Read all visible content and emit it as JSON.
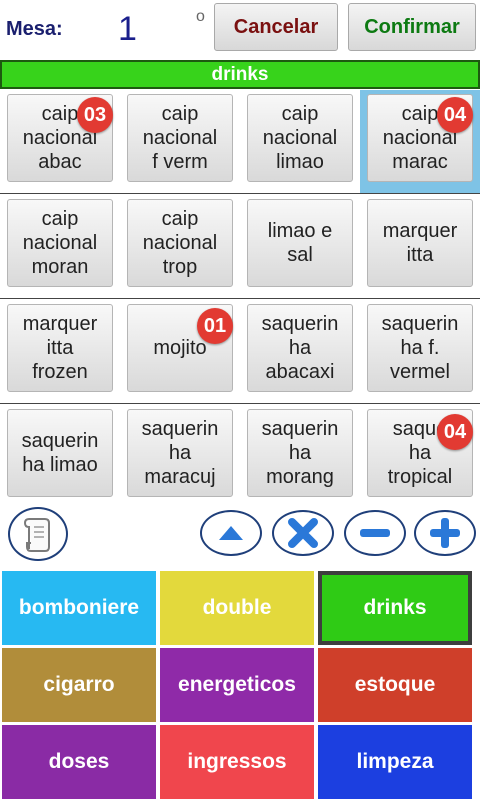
{
  "header": {
    "mesa_label": "Mesa:",
    "mesa_value": "1",
    "mesa_suffix": "o",
    "cancel_label": "Cancelar",
    "confirm_label": "Confirmar"
  },
  "current_category": "drinks",
  "products": [
    {
      "label": "caip\nnacional\nabac",
      "badge": "03"
    },
    {
      "label": "caip\nnacional\nf verm",
      "badge": ""
    },
    {
      "label": "caip\nnacional\nlimao",
      "badge": ""
    },
    {
      "label": "caip\nnacional\nmarac",
      "badge": "04"
    },
    {
      "label": "caip\nnacional\nmoran",
      "badge": ""
    },
    {
      "label": "caip\nnacional\ntrop",
      "badge": ""
    },
    {
      "label": "limao e\nsal",
      "badge": ""
    },
    {
      "label": "marquer\nitta",
      "badge": ""
    },
    {
      "label": "marquer\nitta\nfrozen",
      "badge": ""
    },
    {
      "label": "mojito",
      "badge": "01"
    },
    {
      "label": "saquerin\nha\nabacaxi",
      "badge": ""
    },
    {
      "label": "saquerin\nha f.\nvermel",
      "badge": ""
    },
    {
      "label": "saquerin\nha limao",
      "badge": ""
    },
    {
      "label": "saquerin\nha\nmaracuj",
      "badge": ""
    },
    {
      "label": "saquerin\nha\nmorang",
      "badge": ""
    },
    {
      "label": "saque\nha\ntropical",
      "badge": "04"
    }
  ],
  "categories": [
    {
      "label": "bomboniere",
      "color": "#27b9f2"
    },
    {
      "label": "double",
      "color": "#e3d93c"
    },
    {
      "label": "drinks",
      "color": "#2fcb15"
    },
    {
      "label": "cigarro",
      "color": "#b18d3a"
    },
    {
      "label": "energeticos",
      "color": "#8f2aa8"
    },
    {
      "label": "estoque",
      "color": "#cf3f2a"
    },
    {
      "label": "doses",
      "color": "#8a2ba5"
    },
    {
      "label": "ingressos",
      "color": "#f0464d"
    },
    {
      "label": "limpeza",
      "color": "#1c3fe0"
    }
  ],
  "icons": [
    "scroll-icon",
    "arrow-up-icon",
    "remove-x-icon",
    "minus-icon",
    "plus-icon"
  ]
}
